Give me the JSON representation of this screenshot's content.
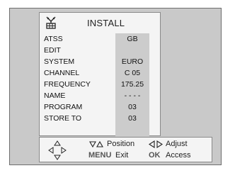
{
  "menu": {
    "title": "INSTALL",
    "items": [
      {
        "label": "ATSS",
        "value": "GB"
      },
      {
        "label": "EDIT",
        "value": ""
      },
      {
        "label": "SYSTEM",
        "value": "EURO"
      },
      {
        "label": "CHANNEL",
        "value": "C 05"
      },
      {
        "label": "FREQUENCY",
        "value": "175.25"
      },
      {
        "label": "NAME",
        "value": "- - - -"
      },
      {
        "label": "PROGRAM",
        "value": "03"
      },
      {
        "label": "STORE TO",
        "value": "03"
      }
    ]
  },
  "help": {
    "position_label": "Position",
    "adjust_label": "Adjust",
    "menu_key": "MENU",
    "exit_label": "Exit",
    "ok_key": "OK",
    "access_label": "Access"
  },
  "colors": {
    "screen_bg": "#c9c9c9",
    "panel_bg": "#f4f4f4",
    "value_column_bg": "#cccccc"
  },
  "icons": [
    "antenna-icon",
    "dpad-icon",
    "up-down-arrows-icon",
    "left-right-arrows-icon"
  ]
}
